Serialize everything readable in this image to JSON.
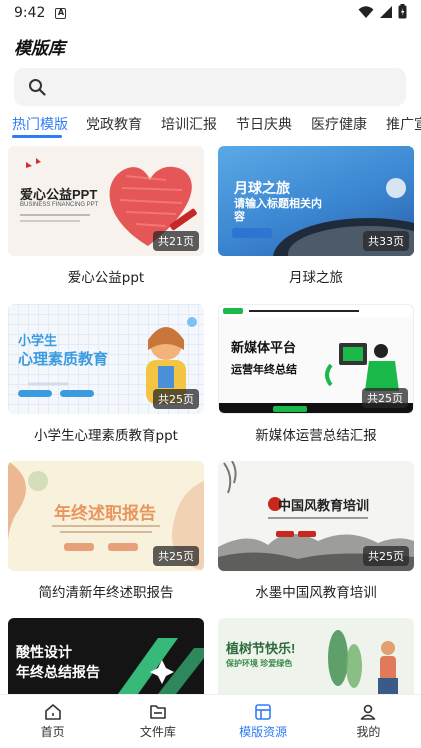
{
  "status": {
    "time": "9:42",
    "notif_glyph": "A"
  },
  "header": {
    "title": "模版库"
  },
  "search": {
    "icon": "search-icon"
  },
  "tabs": [
    {
      "label": "热门模版",
      "active": true
    },
    {
      "label": "党政教育"
    },
    {
      "label": "培训汇报"
    },
    {
      "label": "节日庆典"
    },
    {
      "label": "医疗健康"
    },
    {
      "label": "推广宣"
    }
  ],
  "cards": [
    {
      "title": "爱心公益ppt",
      "count": "共21页",
      "thumb": {
        "heading": "爱心公益PPT",
        "sub": "BUSINESS FINANCING PPT",
        "accent": "#e03a3a"
      }
    },
    {
      "title": "月球之旅",
      "count": "共33页",
      "thumb": {
        "heading": "月球之旅",
        "sub": "请输入标题相关内容",
        "accent": "#3a8fe0"
      }
    },
    {
      "title": "小学生心理素质教育ppt",
      "count": "共25页",
      "thumb": {
        "heading_line1": "小学生",
        "heading_line2": "心理素质教育",
        "accent": "#3b9be0"
      }
    },
    {
      "title": "新媒体运营总结汇报",
      "count": "共25页",
      "thumb": {
        "heading_line1": "新媒体平台",
        "heading_line2": "运营年终总结",
        "accent": "#1bb84a"
      }
    },
    {
      "title": "简约清新年终述职报告",
      "count": "共25页",
      "thumb": {
        "heading": "年终述职报告",
        "accent": "#e8a07a"
      }
    },
    {
      "title": "水墨中国风教育培训",
      "count": "共25页",
      "thumb": {
        "heading": "中国风教育培训",
        "accent": "#c8281e"
      }
    },
    {
      "title": "",
      "count": "",
      "thumb": {
        "heading_line1": "酸性设计",
        "heading_line2": "年终总结报告",
        "accent": "#3dd68c"
      }
    },
    {
      "title": "",
      "count": "",
      "thumb": {
        "heading": "植树节快乐!",
        "sub": "保护环境 珍爱绿色",
        "accent": "#3a8a4a"
      }
    }
  ],
  "nav": [
    {
      "label": "首页",
      "icon": "home-icon"
    },
    {
      "label": "文件库",
      "icon": "folder-icon"
    },
    {
      "label": "模版资源",
      "icon": "templates-icon",
      "active": true
    },
    {
      "label": "我的",
      "icon": "profile-icon"
    }
  ]
}
